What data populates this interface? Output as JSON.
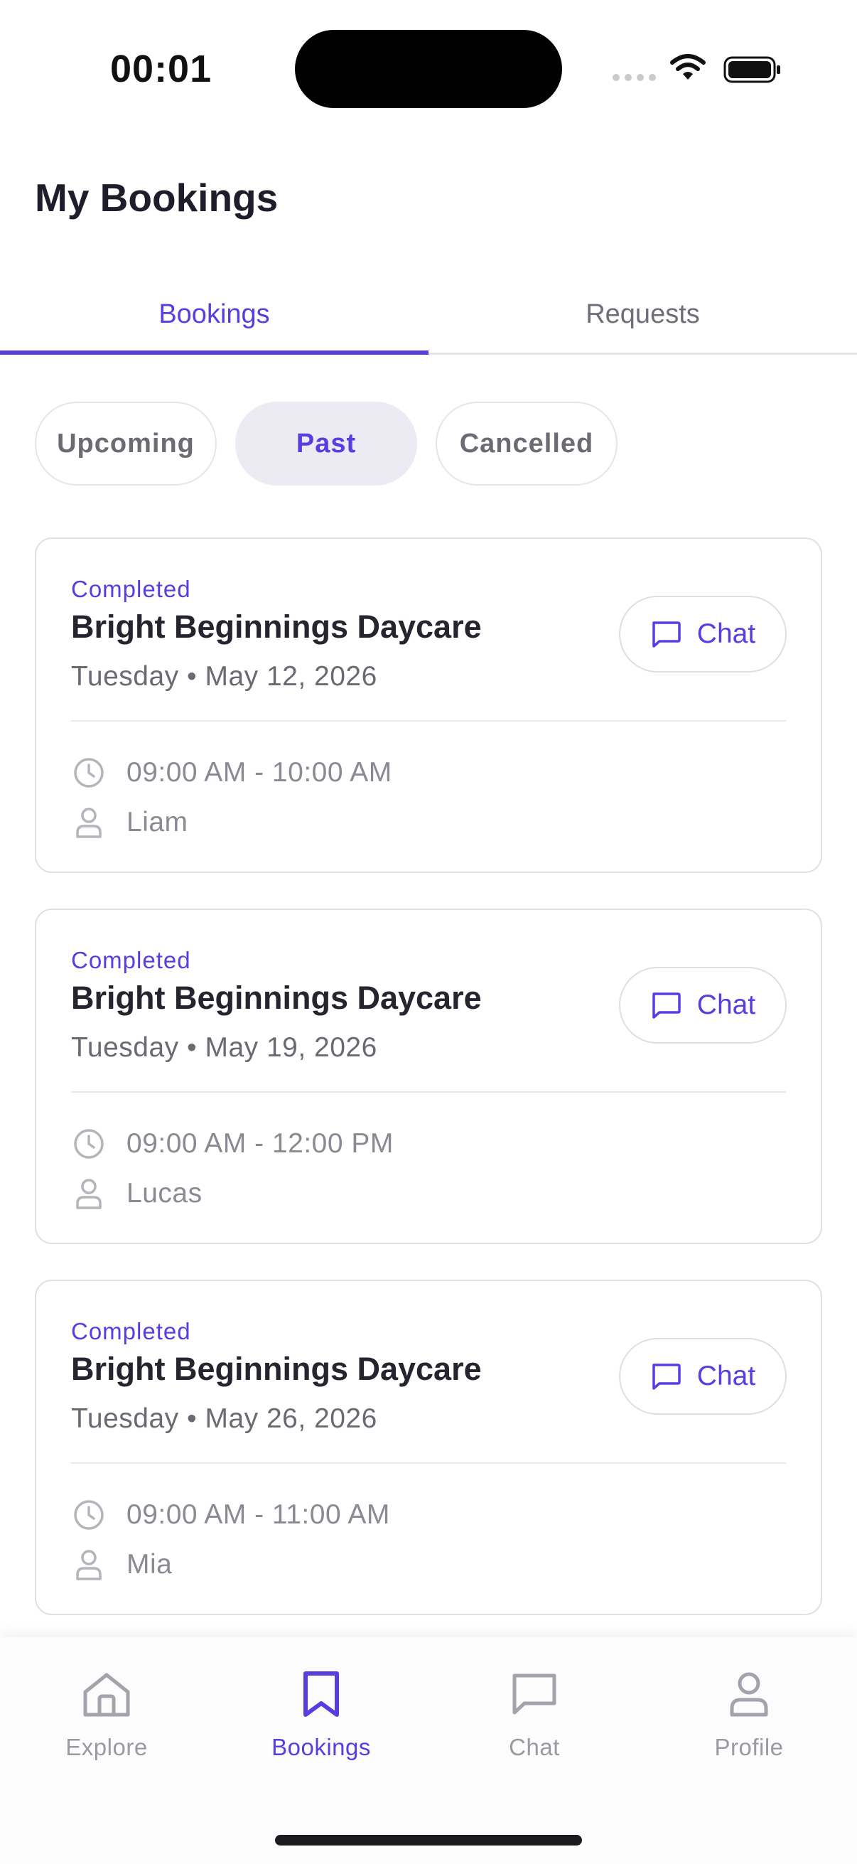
{
  "status_bar": {
    "time": "00:01"
  },
  "page": {
    "title": "My Bookings"
  },
  "tabs": [
    {
      "label": "Bookings",
      "active": true
    },
    {
      "label": "Requests",
      "active": false
    }
  ],
  "filters": [
    {
      "label": "Upcoming",
      "selected": false
    },
    {
      "label": "Past",
      "selected": true
    },
    {
      "label": "Cancelled",
      "selected": false
    }
  ],
  "bookings": [
    {
      "status": "Completed",
      "name": "Bright Beginnings Daycare",
      "date": "Tuesday • May 12, 2026",
      "time": "09:00 AM - 10:00 AM",
      "child": "Liam",
      "chat_label": "Chat"
    },
    {
      "status": "Completed",
      "name": "Bright Beginnings Daycare",
      "date": "Tuesday • May 19, 2026",
      "time": "09:00 AM - 12:00 PM",
      "child": "Lucas",
      "chat_label": "Chat"
    },
    {
      "status": "Completed",
      "name": "Bright Beginnings Daycare",
      "date": "Tuesday • May 26, 2026",
      "time": "09:00 AM - 11:00 AM",
      "child": "Mia",
      "chat_label": "Chat"
    }
  ],
  "bottom_nav": [
    {
      "label": "Explore",
      "icon": "home-icon",
      "active": false
    },
    {
      "label": "Bookings",
      "icon": "bookmark-icon",
      "active": true
    },
    {
      "label": "Chat",
      "icon": "chat-icon",
      "active": false
    },
    {
      "label": "Profile",
      "icon": "user-icon",
      "active": false
    }
  ],
  "colors": {
    "accent": "#5a3de0",
    "muted": "#8a8a92",
    "border": "#e0e0e6"
  }
}
